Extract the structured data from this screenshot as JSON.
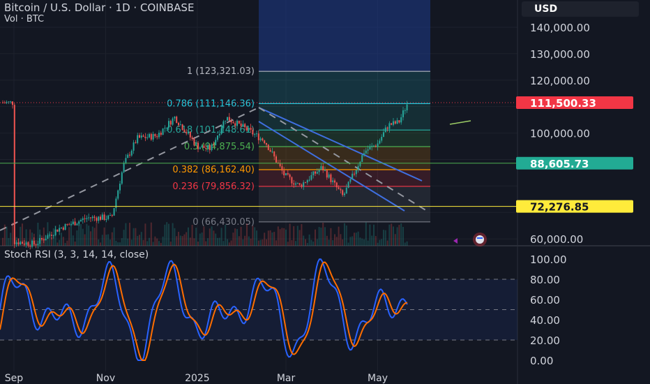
{
  "header": {
    "title": "Bitcoin / U.S. Dollar · 1D · COINBASE",
    "volume_label": "Vol · BTC",
    "currency": "USD"
  },
  "price_axis_labels": [
    "140,000.00",
    "130,000.00",
    "120,000.00",
    "100,000.00",
    "60,000.00"
  ],
  "price_tags": [
    {
      "label": "111,500.33",
      "price": 111500.33,
      "color": "#f23645",
      "text_color": "#ffffff"
    },
    {
      "label": "88,605.73",
      "price": 88605.73,
      "color": "#22ab94",
      "text_color": "#ffffff"
    },
    {
      "label": "72,276.85",
      "price": 72276.85,
      "color": "#ffeb3b",
      "text_color": "#131722"
    }
  ],
  "fib_levels": [
    {
      "label": "1 (123,321.03)",
      "ratio": 1,
      "price": 123321.03,
      "color": "#b2b5be"
    },
    {
      "label": "0.786 (111,146.36)",
      "ratio": 0.786,
      "price": 111146.36,
      "color": "#26c6da"
    },
    {
      "label": "0.618 (101,148.61)",
      "ratio": 0.618,
      "price": 101148.61,
      "color": "#26a69a"
    },
    {
      "label": "0.5 (94,875.54)",
      "ratio": 0.5,
      "price": 94875.54,
      "color": "#4caf50"
    },
    {
      "label": "0.382 (86,162.40)",
      "ratio": 0.382,
      "price": 86162.4,
      "color": "#ff9800"
    },
    {
      "label": "0.236 (79,856.32)",
      "ratio": 0.236,
      "price": 79856.32,
      "color": "#f23645"
    },
    {
      "label": "0 (66,430.05)",
      "ratio": 0,
      "price": 66430.05,
      "color": "#787b86"
    }
  ],
  "horizontal_lines": [
    {
      "price": 88605.73,
      "color": "#4caf50"
    },
    {
      "price": 72276.85,
      "color": "#ffeb3b"
    }
  ],
  "rsi": {
    "title": "Stoch RSI (3, 3, 14, 14, close)",
    "axis_labels": [
      "100.00",
      "80.00",
      "60.00",
      "40.00",
      "20.00",
      "0.00"
    ],
    "k_color": "#2962ff",
    "d_color": "#ff6d00"
  },
  "time_axis_labels": [
    "Sep",
    "Nov",
    "2025",
    "Mar",
    "May"
  ],
  "chart_data": {
    "type": "candlestick",
    "title": "Bitcoin / U.S. Dollar · 1D · COINBASE",
    "ylim": [
      54000,
      148000
    ],
    "price_points": [
      {
        "date": "2024-09-01",
        "price": 59000
      },
      {
        "date": "2024-09-15",
        "price": 58000
      },
      {
        "date": "2024-10-01",
        "price": 64000
      },
      {
        "date": "2024-10-20",
        "price": 68000
      },
      {
        "date": "2024-11-05",
        "price": 68000
      },
      {
        "date": "2024-11-13",
        "price": 88000
      },
      {
        "date": "2024-11-22",
        "price": 98000
      },
      {
        "date": "2024-12-05",
        "price": 99000
      },
      {
        "date": "2024-12-17",
        "price": 106000
      },
      {
        "date": "2025-01-01",
        "price": 95000
      },
      {
        "date": "2025-01-10",
        "price": 94000
      },
      {
        "date": "2025-01-20",
        "price": 106000
      },
      {
        "date": "2025-02-01",
        "price": 102000
      },
      {
        "date": "2025-02-15",
        "price": 97000
      },
      {
        "date": "2025-02-28",
        "price": 84000
      },
      {
        "date": "2025-03-10",
        "price": 80000
      },
      {
        "date": "2025-03-25",
        "price": 87000
      },
      {
        "date": "2025-04-08",
        "price": 76000
      },
      {
        "date": "2025-04-22",
        "price": 93000
      },
      {
        "date": "2025-05-01",
        "price": 96000
      },
      {
        "date": "2025-05-08",
        "price": 103000
      },
      {
        "date": "2025-05-15",
        "price": 104000
      },
      {
        "date": "2025-05-21",
        "price": 111500
      }
    ],
    "current_price": 111500.33,
    "stoch_rsi_range": [
      0,
      100
    ],
    "stoch_rsi_bands": [
      20,
      50,
      80
    ]
  }
}
